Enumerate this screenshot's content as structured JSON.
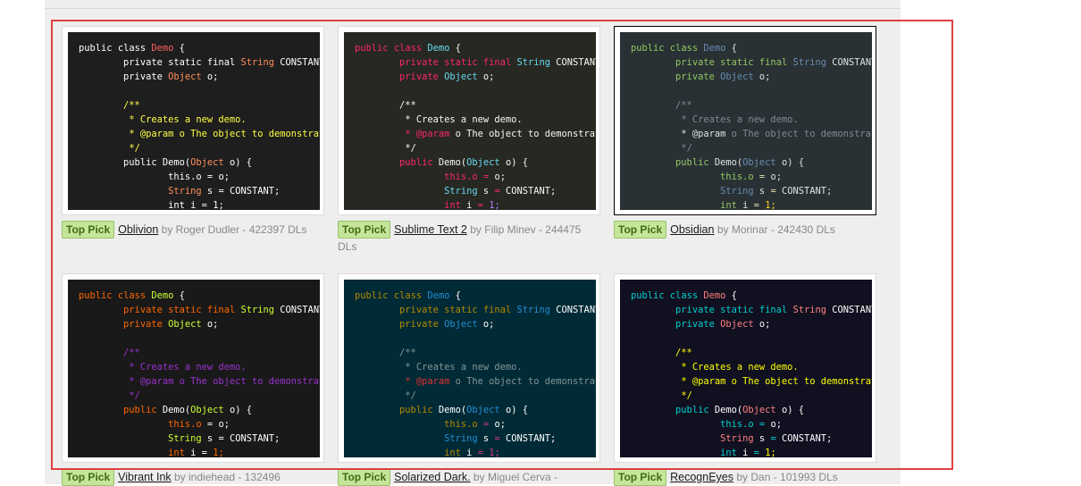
{
  "badge_label": "Top Pick",
  "by_word": "by",
  "cards": [
    {
      "name": "Oblivion",
      "author": "Roger Dudler",
      "downloads": "422397 DLs",
      "selected": false,
      "colors": {
        "bg": "#1e1e1e",
        "fg": "#ffffff",
        "kw": "#ffffff",
        "cls": "#ff5f5f",
        "type": "#ff8c5a",
        "prop": "#ffffff",
        "comment": "#ffff45",
        "param": "#ffff45",
        "num": "#ffffff",
        "op": "#ffffff"
      }
    },
    {
      "name": "Sublime Text 2",
      "author": "Filip Minev",
      "downloads": "244475 DLs",
      "selected": false,
      "colors": {
        "bg": "#272822",
        "fg": "#f8f8f2",
        "kw": "#f92672",
        "cls": "#66d9ef",
        "type": "#66d9ef",
        "prop": "#f92672",
        "comment": "#f8f8f2",
        "param": "#f92672",
        "num": "#ae81ff",
        "op": "#f92672"
      }
    },
    {
      "name": "Obsidian",
      "author": "Morinar",
      "downloads": "242430 DLs",
      "selected": true,
      "colors": {
        "bg": "#293134",
        "fg": "#e0e2e4",
        "kw": "#93c763",
        "cls": "#678cb1",
        "type": "#678cb1",
        "prop": "#93c763",
        "comment": "#7d8c93",
        "param": "#e0e2e4",
        "num": "#ffcd22",
        "op": "#e8e2b7"
      }
    },
    {
      "name": "Vibrant Ink",
      "author": "indiehead",
      "downloads": "132496",
      "selected": false,
      "colors": {
        "bg": "#191919",
        "fg": "#ffffff",
        "kw": "#ff6600",
        "cls": "#ccff33",
        "type": "#ccff33",
        "prop": "#ff6600",
        "comment": "#9933cc",
        "param": "#9933cc",
        "num": "#ff6600",
        "op": "#ffffff"
      }
    },
    {
      "name": "Solarized Dark.",
      "author": "Miguel Cerva",
      "downloads": "",
      "selected": false,
      "colors": {
        "bg": "#002b36",
        "fg": "#ffffff",
        "kw": "#b58900",
        "cls": "#268bd2",
        "type": "#268bd2",
        "prop": "#b58900",
        "comment": "#839496",
        "param": "#dc322f",
        "num": "#d33682",
        "op": "#d33682"
      }
    },
    {
      "name": "RecognEyes",
      "author": "Dan",
      "downloads": "101993 DLs",
      "selected": false,
      "colors": {
        "bg": "#101020",
        "fg": "#ffffff",
        "kw": "#00d0d0",
        "cls": "#ff8080",
        "type": "#ff8080",
        "prop": "#00d0d0",
        "comment": "#ffff00",
        "param": "#ffff00",
        "num": "#ffff00",
        "op": "#00d0d0"
      }
    }
  ],
  "code_sample": {
    "l1": [
      "public",
      "class",
      "Demo",
      "{"
    ],
    "l2": [
      "private",
      "static",
      "final",
      "String",
      "CONSTANT"
    ],
    "l3": [
      "private",
      "Object",
      "o;"
    ],
    "c1": "/**",
    "c2a": "* Creates a new demo.",
    "c3a": "* @param",
    "c3b": "o The object to demonstrate.",
    "c4": "*/",
    "l5": [
      "public",
      "Demo(",
      "Object",
      "o) {"
    ],
    "l6": [
      "this",
      ".o",
      "=",
      "o;"
    ],
    "l7": [
      "String",
      "s",
      "=",
      "CONSTANT;"
    ],
    "l8": [
      "int",
      "i",
      "=",
      "1;"
    ]
  }
}
